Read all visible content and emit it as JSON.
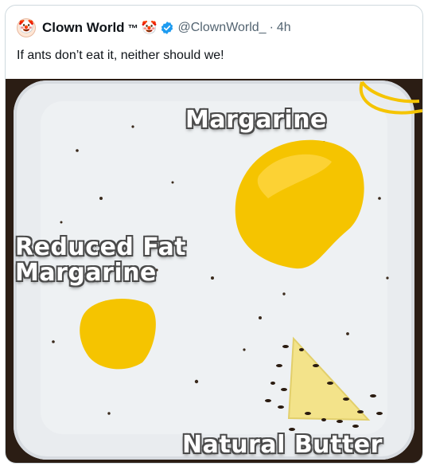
{
  "tweet": {
    "avatar_icon": "clown-face-icon",
    "avatar_emoji": "🤡",
    "display_name": "Clown World",
    "tm": "™",
    "name_emoji": "🤡",
    "verified_icon": "verified-badge-icon",
    "handle": "@ClownWorld_",
    "separator": "·",
    "time": "4h",
    "text": "If ants don’t eat it, neither should we!"
  },
  "media": {
    "label_margarine": "Margarine",
    "label_reduced_fat": "Reduced Fat\nMargarine",
    "label_natural_butter": "Natural Butter"
  },
  "colors": {
    "verified_blue": "#1d9bf0",
    "margarine_yellow": "#f5c400",
    "butter_pale": "#f3e38a",
    "tray_white": "#e9ecef"
  }
}
